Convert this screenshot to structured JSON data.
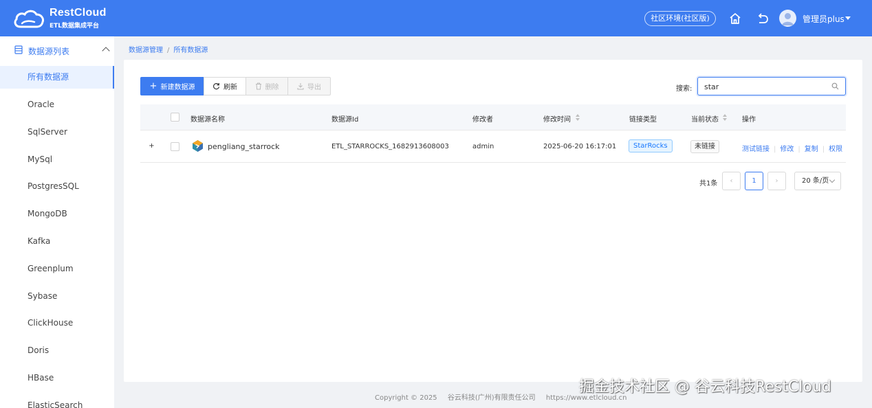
{
  "header": {
    "logo_title": "RestCloud",
    "logo_subtitle": "ETL数据集成平台",
    "env_button": "社区环境(社区版)",
    "user_name": "管理员plus"
  },
  "sidebar": {
    "section_label": "数据源列表",
    "items": [
      {
        "label": "所有数据源",
        "active": true
      },
      {
        "label": "Oracle"
      },
      {
        "label": "SqlServer"
      },
      {
        "label": "MySql"
      },
      {
        "label": "PostgresSQL"
      },
      {
        "label": "MongoDB"
      },
      {
        "label": "Kafka"
      },
      {
        "label": "Greenplum"
      },
      {
        "label": "Sybase"
      },
      {
        "label": "ClickHouse"
      },
      {
        "label": "Doris"
      },
      {
        "label": "HBase"
      },
      {
        "label": "ElasticSearch"
      }
    ]
  },
  "breadcrumb": {
    "parent": "数据源管理",
    "separator": "/",
    "current": "所有数据源"
  },
  "toolbar": {
    "new_label": "新建数据源",
    "refresh_label": "刷新",
    "delete_label": "删除",
    "export_label": "导出"
  },
  "search": {
    "label": "搜索:",
    "value": "star"
  },
  "table": {
    "columns": [
      "数据源名称",
      "数据源Id",
      "修改者",
      "修改时间",
      "链接类型",
      "当前状态",
      "操作"
    ],
    "rows": [
      {
        "name": "pengliang_starrock",
        "id": "ETL_STARROCKS_1682913608003",
        "modifier": "admin",
        "modified_time": "2025-06-20 16:17:01",
        "link_type": "StarRocks",
        "status": "未链接",
        "actions": [
          "测试链接",
          "修改",
          "复制",
          "权限"
        ]
      }
    ]
  },
  "pagination": {
    "total": "共1条",
    "current_page": "1",
    "page_size": "20 条/页"
  },
  "footer": {
    "copyright": "Copyright © 2025",
    "company": "谷云科技(广州)有限责任公司",
    "url": "https://www.etlcloud.cn"
  },
  "watermark": "掘金技术社区 @ 谷云科技RestCloud",
  "colors": {
    "primary": "#3d7cf0",
    "header_bg": "#3d7cf0",
    "tag_blue": "#1677ff"
  }
}
